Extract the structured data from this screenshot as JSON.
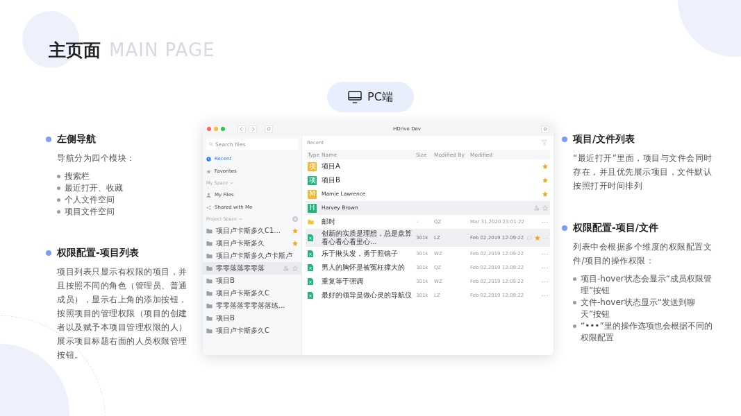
{
  "page": {
    "title": "主页面",
    "title_en": "MAIN PAGE"
  },
  "platform_badge": {
    "label": "PC端"
  },
  "left_sections": [
    {
      "heading": "左侧导航",
      "intro": "导航分为四个模块：",
      "bullets": [
        "搜索栏",
        "最近打开、收藏",
        "个人文件空间",
        "项目文件空间"
      ]
    },
    {
      "heading": "权限配置-项目列表",
      "intro": "项目列表只显示有权限的项目，并且按照不同的角色（管理员、普通成员），显示右上角的添加按钮，按照项目的管理权限（项目的创建者以及赋予本项目管理权限的人）展示项目标题右面的人员权限管理按钮。"
    }
  ],
  "right_sections": [
    {
      "heading": "项目/文件列表",
      "intro": "“最近打开”里面，项目与文件会同时存在，并且优先展示项目，文件默认按照打开时间排列"
    },
    {
      "heading": "权限配置-项目/文件",
      "intro": "列表中会根据多个维度的权限配置文件/项目的操作权限：",
      "bullets": [
        "项目-hover状态会显示“成员权限管理”按钮",
        "文件-hover状态显示“发送到聊天”按钮",
        "“•••”里的操作选项也会根据不同的权限配置"
      ]
    }
  ],
  "app": {
    "window_title": "HDrive Dev",
    "search": {
      "placeholder": "Search files"
    },
    "nav": [
      {
        "label": "Recent",
        "selected": true
      },
      {
        "label": "Favorites",
        "selected": false
      }
    ],
    "my_space": {
      "label": "My Space",
      "items": [
        {
          "label": "My Files",
          "selected": false
        },
        {
          "label": "Shared with Me",
          "selected": false
        }
      ]
    },
    "project_space": {
      "label": "Project Space",
      "projects": [
        {
          "name": "项目卢卡斯多久C1...",
          "starred": true,
          "hovered": false
        },
        {
          "name": "项目卢卡斯多久",
          "starred": true,
          "hovered": false
        },
        {
          "name": "项目卢卡斯多久卢卡斯卢",
          "starred": false,
          "hovered": false
        },
        {
          "name": "零零落落零零落",
          "starred": false,
          "hovered": true
        },
        {
          "name": "项目B",
          "starred": false,
          "hovered": false
        },
        {
          "name": "项目卢卡斯多久C",
          "starred": false,
          "hovered": false
        },
        {
          "name": "零零落落零零落落练...",
          "starred": false,
          "hovered": false
        },
        {
          "name": "项目B",
          "starred": false,
          "hovered": false
        },
        {
          "name": "项目卢卡斯多久C",
          "starred": false,
          "hovered": false
        }
      ]
    },
    "list_title": "Recent",
    "columns": [
      "Type",
      "Name",
      "Size",
      "Modified By",
      "Modified"
    ],
    "rows": [
      {
        "kind": "project",
        "badge": "项",
        "color": "#f5b82e",
        "name": "项目A",
        "starred": true,
        "hovered": false
      },
      {
        "kind": "project",
        "badge": "项",
        "color": "#22b57c",
        "name": "项目B",
        "starred": true,
        "hovered": false
      },
      {
        "kind": "project",
        "badge": "M",
        "color": "#f5b82e",
        "name": "Mamie Lawrence",
        "starred": true,
        "hovered": false
      },
      {
        "kind": "project",
        "badge": "H",
        "color": "#22b57c",
        "name": "Harvey Brown",
        "starred": false,
        "hovered": true
      },
      {
        "kind": "folder",
        "name": "邮时",
        "size": "–",
        "modified_by": "QZ",
        "modified": "Mar 31,2020  23:01:22",
        "starred": false,
        "hovered": false
      },
      {
        "kind": "file",
        "name": "创新的实质是理想，总是盘算看心看心看里心...",
        "size": "301k",
        "modified_by": "LZ",
        "modified": "Feb 02,2019  12:09:22",
        "starred": true,
        "hovered": true
      },
      {
        "kind": "file",
        "name": "乐于揪头发，勇于照镜子",
        "size": "301k",
        "modified_by": "WZ",
        "modified": "Feb 02,2019  12:09:22",
        "starred": false,
        "hovered": false
      },
      {
        "kind": "file",
        "name": "男人的胸怀是被冤枉撑大的",
        "size": "301k",
        "modified_by": "QZ",
        "modified": "Feb 02,2019  12:09:22",
        "starred": false,
        "hovered": false
      },
      {
        "kind": "file",
        "name": "重复等于强调",
        "size": "301k",
        "modified_by": "WZ",
        "modified": "Feb 02,2019  12:09:22",
        "starred": false,
        "hovered": false
      },
      {
        "kind": "file",
        "name": "最好的领导是做心灵的导航仪",
        "size": "301k",
        "modified_by": "LZ",
        "modified": "Feb 02,2019  12:09:22",
        "starred": false,
        "hovered": false
      }
    ]
  }
}
